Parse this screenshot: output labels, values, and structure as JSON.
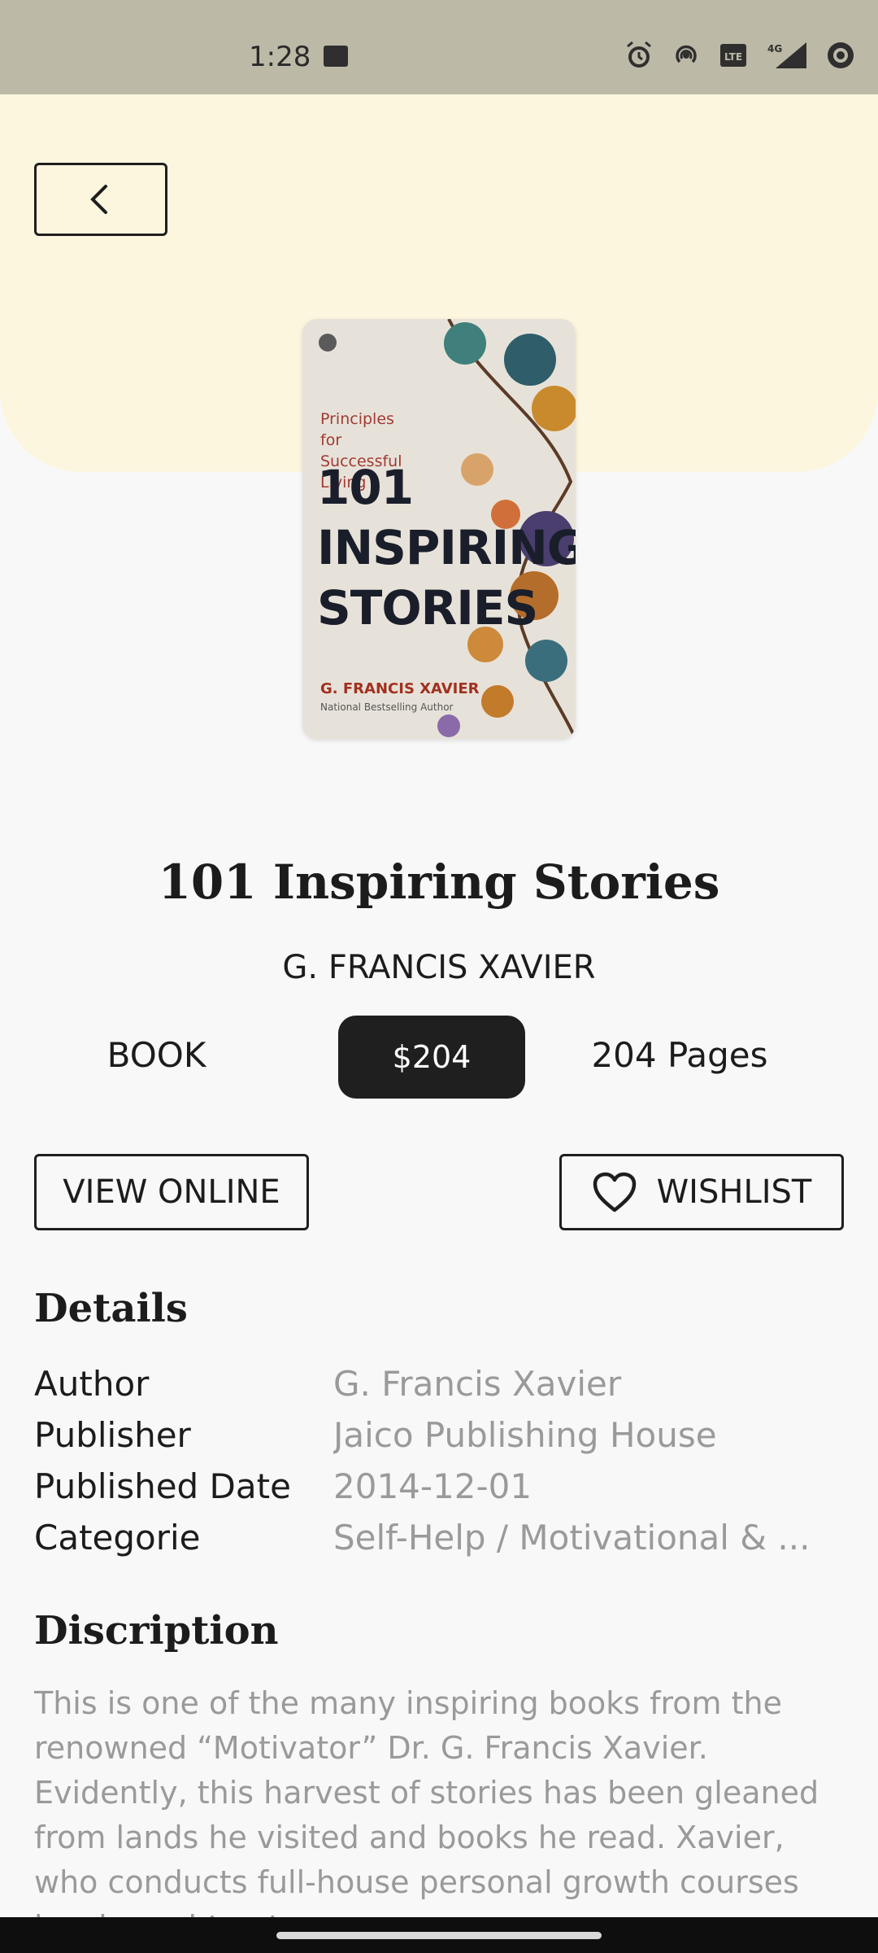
{
  "status_bar": {
    "time": "1:28",
    "icons": [
      "image-icon",
      "alarm-icon",
      "hotspot-icon",
      "volte-icon",
      "signal-4g-icon",
      "record-icon"
    ],
    "volte_text": "Vo LTE",
    "net_text": "4G"
  },
  "book": {
    "cover": {
      "subtitle": "Principles for Successful Living",
      "title_lines": [
        "101",
        "INSPIRING",
        "STORIES"
      ],
      "author": "G. FRANCIS XAVIER",
      "tagline": "National Bestselling Author"
    },
    "title": "101 Inspiring Stories",
    "author_caps": "G. FRANCIS XAVIER",
    "type": "BOOK",
    "price": "$204",
    "pages": "204 Pages"
  },
  "actions": {
    "view_online": "VIEW ONLINE",
    "wishlist": "WISHLIST"
  },
  "details": {
    "heading": "Details",
    "rows": [
      {
        "label": "Author",
        "value": "G. Francis Xavier"
      },
      {
        "label": "Publisher",
        "value": "Jaico Publishing House"
      },
      {
        "label": "Published Date",
        "value": "2014-12-01"
      },
      {
        "label": "Categorie",
        "value": "Self-Help / Motivational & ..."
      }
    ]
  },
  "description": {
    "heading": "Discription",
    "text": "This is one of the many inspiring books from the renowned “Motivator” Dr. G. Francis Xavier. Evidently, this harvest of stories has been gleaned from lands he visited and books he read. Xavier, who conducts full-house personal growth courses has brought out"
  },
  "colors": {
    "hero_bg": "#fcf6df",
    "status_bar_bg": "#bdb9a7",
    "price_chip_bg": "#1f1f1f",
    "muted_text": "#9a9a9a"
  }
}
